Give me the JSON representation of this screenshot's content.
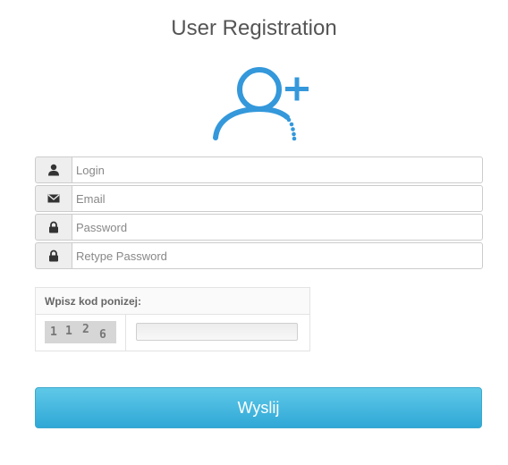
{
  "page": {
    "title": "User Registration"
  },
  "form": {
    "fields": [
      {
        "icon": "user-icon",
        "placeholder": "Login",
        "value": ""
      },
      {
        "icon": "envelope-icon",
        "placeholder": "Email",
        "value": ""
      },
      {
        "icon": "lock-icon",
        "placeholder": "Password",
        "value": ""
      },
      {
        "icon": "lock-icon",
        "placeholder": "Retype Password",
        "value": ""
      }
    ],
    "captcha": {
      "label": "Wpisz kod ponizej:",
      "digits": [
        "1",
        "1",
        "2",
        "6"
      ],
      "value": ""
    },
    "submit_label": "Wyslij"
  },
  "colors": {
    "accent": "#3498db",
    "button_top": "#5fc8e8",
    "button_bottom": "#2fa8d6",
    "addon_bg": "#eeeeee"
  },
  "icons": {
    "logo": "add-user-icon"
  }
}
